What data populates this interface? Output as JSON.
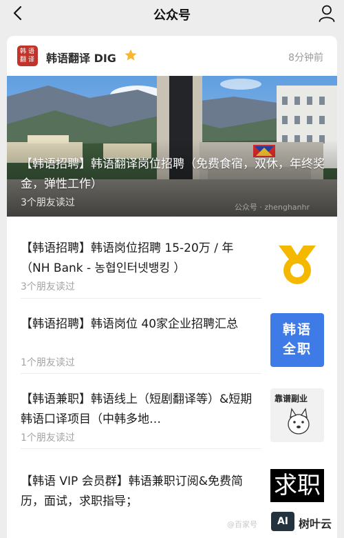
{
  "nav": {
    "title": "公众号"
  },
  "account": {
    "name": "韩语翻译 DIG",
    "logo_chars": [
      "韩",
      "语",
      "翻",
      "译"
    ],
    "time": "8分钟前"
  },
  "hero": {
    "title": "【韩语招聘】韩语翻译岗位招聘（免费食宿，双休，年终奖金，弹性工作）",
    "reads": "3个朋友读过",
    "watermark": "公众号 · zhenghanhr"
  },
  "articles": [
    {
      "title": "【韩语招聘】韩语岗位招聘 15-20万 / 年（NH Bank - 농협인터넷뱅킹 ）",
      "reads": "3个朋友读过",
      "thumb": "nh-bank-logo"
    },
    {
      "title": "【韩语招聘】韩语岗位 40家企业招聘汇总",
      "reads": "1个朋友读过",
      "thumb": "blue-text",
      "thumb_text": "韩语\n全职"
    },
    {
      "title": "【韩语兼职】韩语线上（短剧翻译等）&短期韩语口译项目（中韩多地…",
      "reads": "1个朋友读过",
      "thumb": "gray-text",
      "thumb_text": "靠谱副业"
    },
    {
      "title": "【韩语 VIP 会员群】韩语兼职订阅&免费简历，面试，求职指导；",
      "reads": "",
      "thumb": "black-text",
      "thumb_text": "求职"
    }
  ],
  "footer": {
    "watermark": "@百家号",
    "brand_box": "AI",
    "brand_text": "树叶云"
  },
  "colors": {
    "accent_blue": "#3f7be6",
    "logo_red": "#c0352b",
    "nh_yellow": "#f5b800",
    "star": "#f7b731"
  }
}
